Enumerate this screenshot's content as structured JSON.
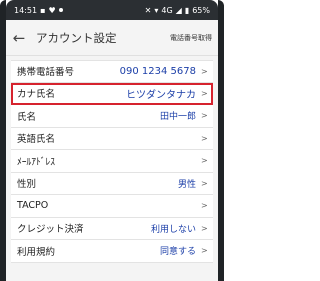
{
  "status_bar": {
    "time": "14:51",
    "network": "4G",
    "battery": "65%"
  },
  "header": {
    "back_icon": "arrow-left-icon",
    "title": "アカウント設定",
    "action_label": "電話番号取得"
  },
  "rows": [
    {
      "label": "携帯電話番号",
      "value": "090 1234 5678",
      "chevron": ">"
    },
    {
      "label": "カナ氏名",
      "value": "ヒツダンタナカ",
      "chevron": ">"
    },
    {
      "label": "氏名",
      "value": "田中一郎",
      "chevron": ">"
    },
    {
      "label": "英語氏名",
      "value": "",
      "chevron": ">"
    },
    {
      "label": "ﾒｰﾙｱﾄﾞﾚｽ",
      "value": "",
      "chevron": ">"
    },
    {
      "label": "性別",
      "value": "男性",
      "chevron": ">"
    },
    {
      "label": "TACPO",
      "value": "",
      "chevron": ">"
    },
    {
      "label": "クレジット決済",
      "value": "利用しない",
      "chevron": ">"
    },
    {
      "label": "利用規約",
      "value": "同意する",
      "chevron": ">"
    }
  ],
  "colors": {
    "value_text": "#1c3fa8",
    "highlight_border": "#d6232e",
    "status_bar_bg": "#2b2f33"
  }
}
